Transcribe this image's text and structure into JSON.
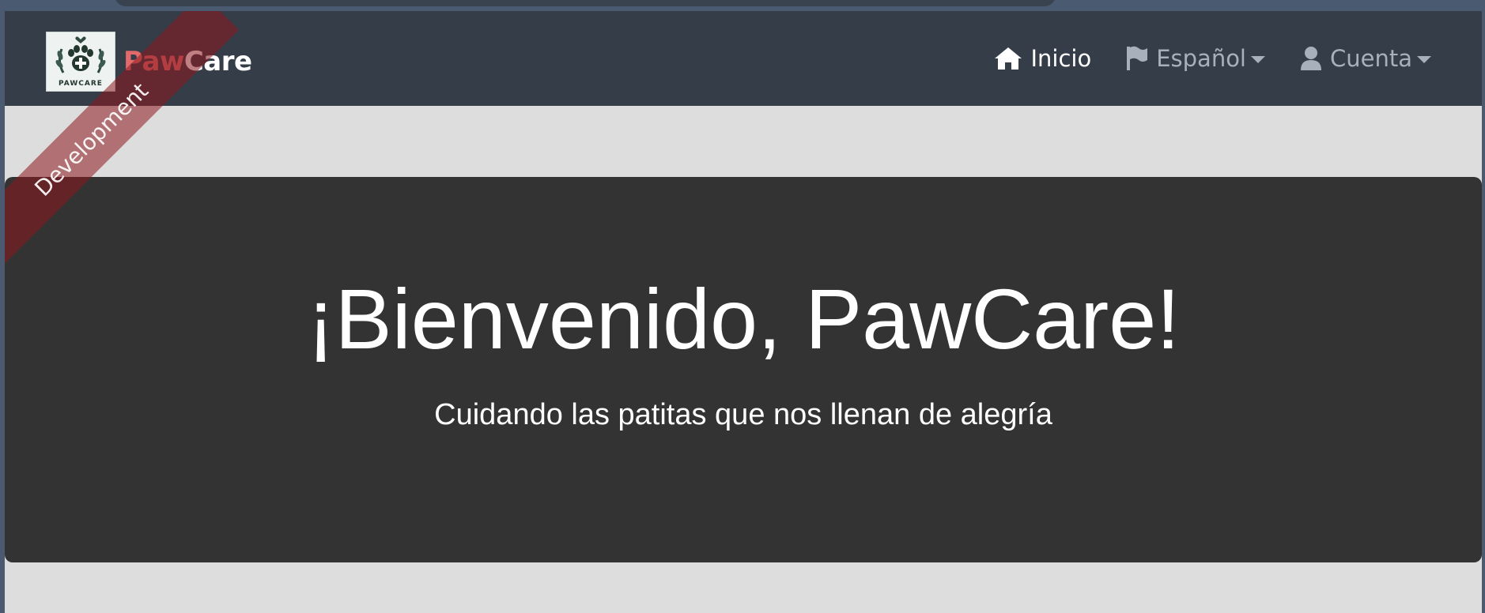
{
  "brand": {
    "logo_text": "PAWCARE",
    "name_accent": "Paw",
    "name_rest": "Care"
  },
  "nav": {
    "home_label": "Inicio",
    "language_label": "Español",
    "account_label": "Cuenta"
  },
  "hero": {
    "title": "¡Bienvenido, PawCare!",
    "subtitle": "Cuidando las patitas que nos llenan de alegría"
  },
  "ribbon": {
    "label": "Development"
  },
  "colors": {
    "navbar": "#353d48",
    "hero": "#333333",
    "page": "#dddddd",
    "brand_accent": "#e26a6a",
    "ribbon": "#8c181e"
  },
  "icons": {
    "home": "home-icon",
    "language": "flag-icon",
    "account": "user-icon",
    "logo": "paw-logo"
  }
}
